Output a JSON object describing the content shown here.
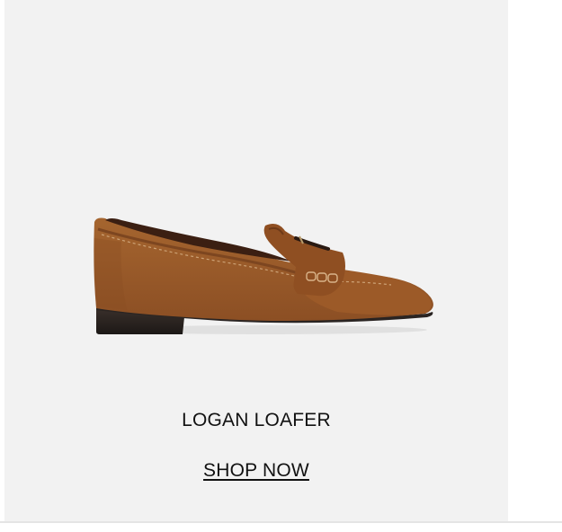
{
  "product": {
    "name": "LOGAN LOAFER",
    "image_alt": "tan suede loafer",
    "image_icon": "loafer-shoe-illustration",
    "colors": {
      "suede": "#9a5a2a",
      "suede_dark": "#7d4620",
      "sole": "#2a2422",
      "stitch": "#d9b48a",
      "card_background": "#f2f2f2"
    }
  },
  "cta": {
    "label": "SHOP NOW"
  }
}
